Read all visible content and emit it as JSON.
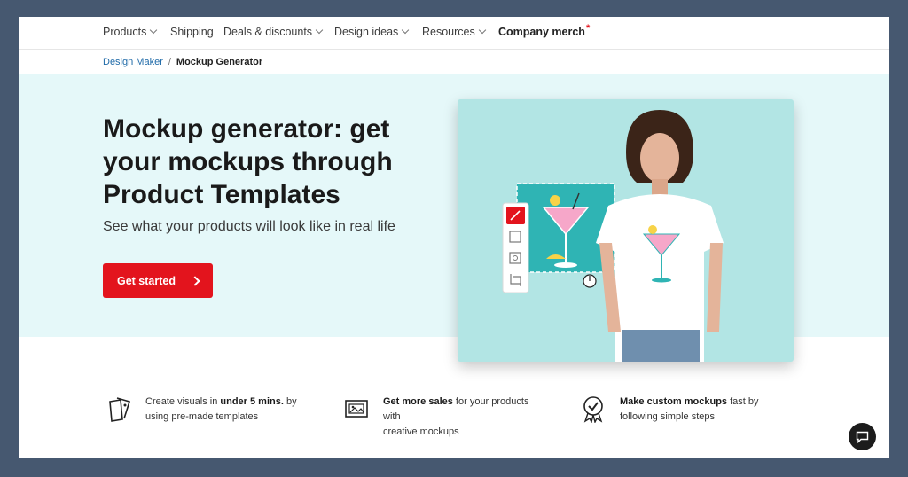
{
  "nav": {
    "items": [
      {
        "label": "Products",
        "has_dropdown": true
      },
      {
        "label": "Shipping",
        "has_dropdown": false
      },
      {
        "label": "Deals & discounts",
        "has_dropdown": true
      },
      {
        "label": "Design ideas",
        "has_dropdown": true
      },
      {
        "label": "Resources",
        "has_dropdown": true
      }
    ],
    "company_merch": {
      "label": "Company merch",
      "marker": "*"
    }
  },
  "breadcrumb": {
    "link": "Design Maker",
    "separator": "/",
    "current": "Mockup Generator"
  },
  "hero": {
    "title_lines": [
      "Mockup generator: get",
      "your mockups through",
      "Product Templates"
    ],
    "subtitle": "See what your products will look like in real life",
    "cta_label": "Get started",
    "visual_tools": [
      "magic-wand-icon",
      "transform-icon",
      "pattern-icon",
      "crop-icon"
    ]
  },
  "features": [
    {
      "icon": "template-icon",
      "t1": "Create visuals in ",
      "b1": "under 5 mins.",
      "t2": " by",
      "t3": "using pre-made templates"
    },
    {
      "icon": "mockup-image-icon",
      "b1": "Get more sales",
      "t2": " for your products with",
      "t3": "creative mockups"
    },
    {
      "icon": "badge-check-icon",
      "b1": "Make custom mockups",
      "t2": " fast by",
      "t3": "following simple steps"
    }
  ],
  "colors": {
    "accent": "#e3141d",
    "link": "#1f6aa8",
    "hero_bg": "#e5f8f9",
    "visual_bg": "#b2e5e4",
    "page_bg": "#465870"
  },
  "chat": {
    "icon": "chat-bubble-icon"
  }
}
